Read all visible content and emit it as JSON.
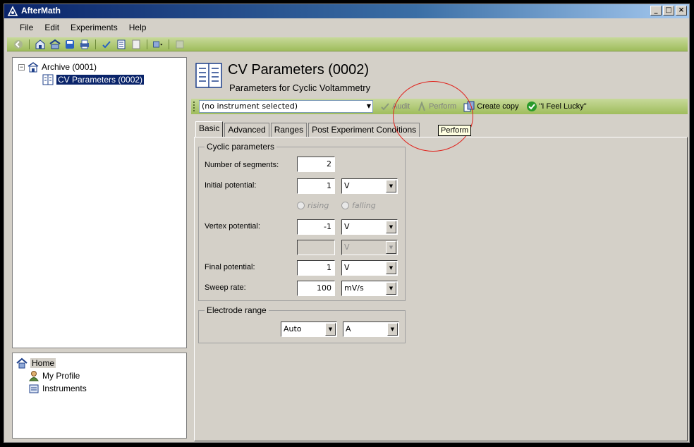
{
  "window": {
    "title": "AfterMath"
  },
  "menu": [
    "File",
    "Edit",
    "Experiments",
    "Help"
  ],
  "tree": {
    "archive": "Archive (0001)",
    "cv_params": "CV Parameters (0002)",
    "expander": "−"
  },
  "nav": {
    "home": "Home",
    "profile": "My Profile",
    "instruments": "Instruments"
  },
  "page": {
    "title": "CV Parameters (0002)",
    "subtitle": "Parameters for Cyclic Voltammetry"
  },
  "actions": {
    "instrument_value": "(no instrument selected)",
    "audit": "Audit",
    "perform": "Perform",
    "create_copy": "Create copy",
    "feel_lucky": "\"I Feel Lucky\""
  },
  "tabs": [
    "Basic",
    "Advanced",
    "Ranges",
    "Post Experiment Conditions"
  ],
  "tooltip": "Perform",
  "cyclic": {
    "legend": "Cyclic parameters",
    "segments_label": "Number of segments:",
    "segments_value": "2",
    "initial_label": "Initial potential:",
    "initial_value": "1",
    "initial_unit": "V",
    "rising": "rising",
    "falling": "falling",
    "vertex_label": "Vertex potential:",
    "vertex_value": "-1",
    "vertex_unit": "V",
    "vertex2_value": "",
    "vertex2_unit": "V",
    "final_label": "Final potential:",
    "final_value": "1",
    "final_unit": "V",
    "sweep_label": "Sweep rate:",
    "sweep_value": "100",
    "sweep_unit": "mV/s"
  },
  "electrode": {
    "legend": "Electrode range",
    "mode": "Auto",
    "unit": "A"
  }
}
